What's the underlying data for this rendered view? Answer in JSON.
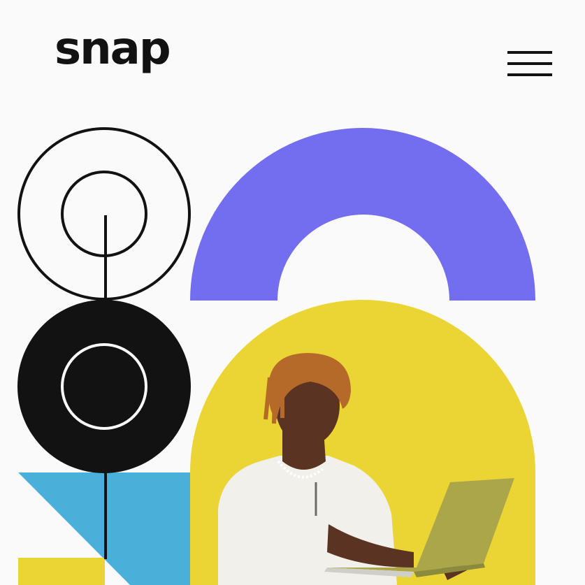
{
  "header": {
    "logo_text": "snap",
    "menu_icon": "hamburger-menu-icon"
  },
  "hero": {
    "photo_subject": "person-with-laptop",
    "colors": {
      "background": "#fafafa",
      "ink": "#121212",
      "purple": "#736eef",
      "yellow": "#ead535",
      "blue": "#4ab0da",
      "skin": "#5a3322",
      "hair": "#b56a2a",
      "shirt": "#f2f0ea",
      "laptop": "#aca64a"
    }
  }
}
